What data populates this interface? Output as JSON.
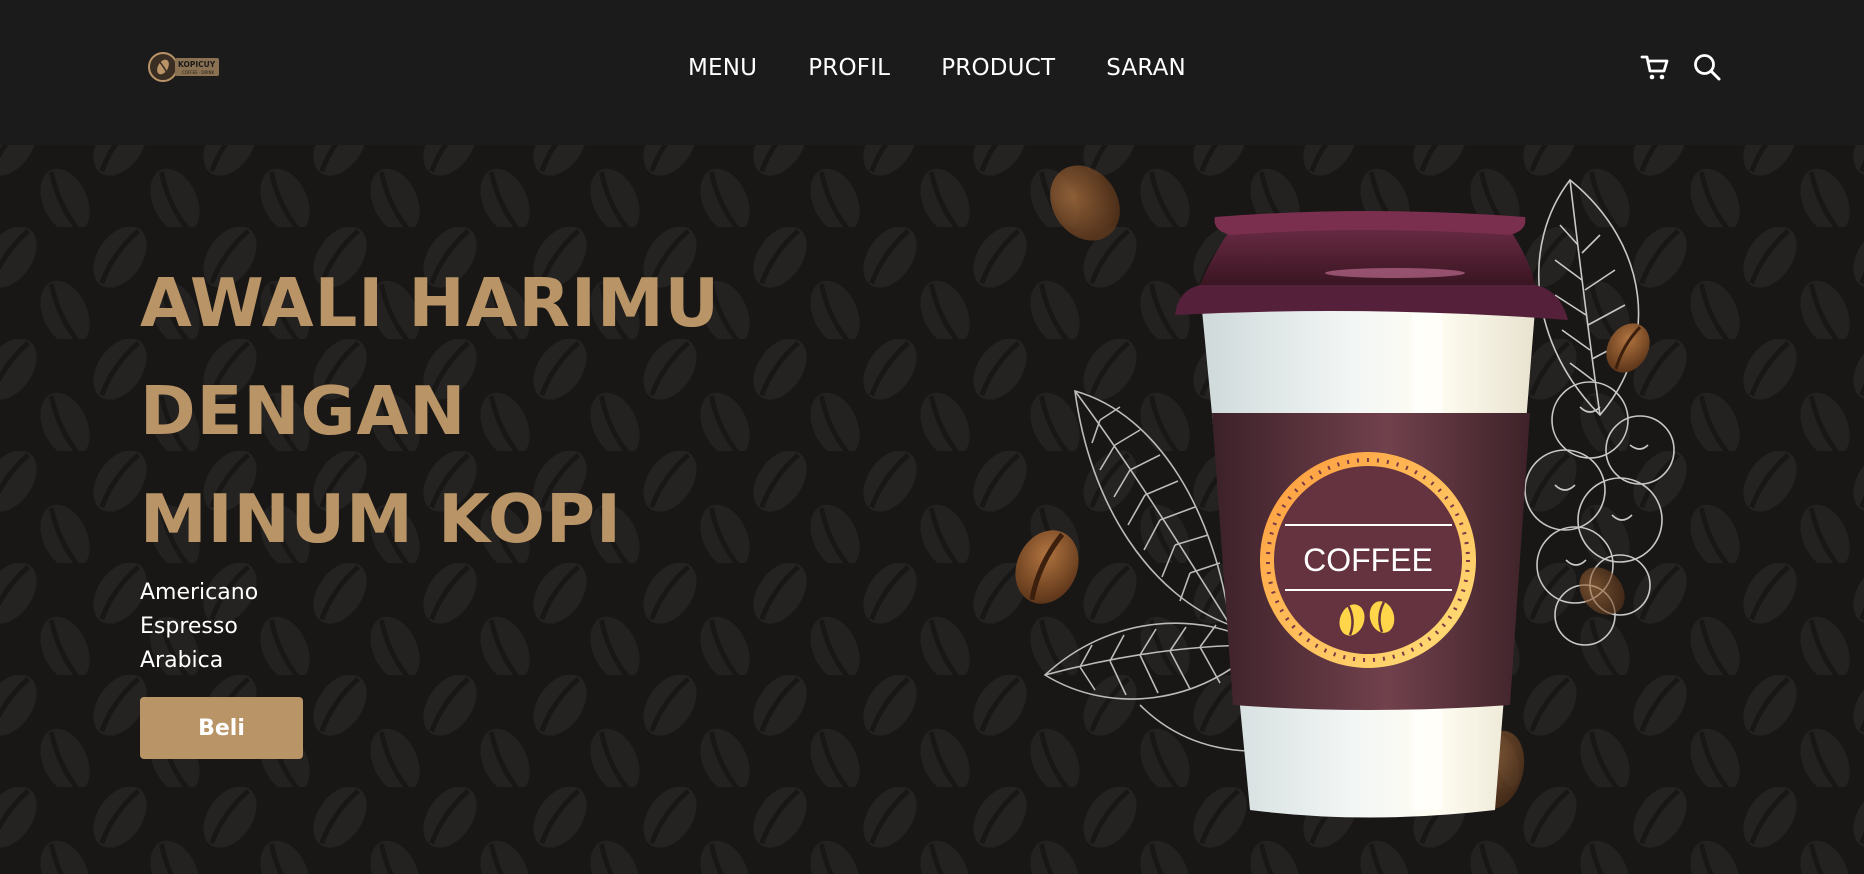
{
  "brand": {
    "name": "KOPICUY",
    "tagline": "COFFEE · DRINK",
    "accent_color": "#b99467",
    "background_color": "#1b1b1b"
  },
  "nav": {
    "items": [
      {
        "label": "MENU"
      },
      {
        "label": "PROFIL"
      },
      {
        "label": "PRODUCT"
      },
      {
        "label": "SARAN"
      }
    ],
    "icons": [
      "cart-icon",
      "search-icon"
    ]
  },
  "hero": {
    "headline_lines": [
      "AWALI HARIMU",
      "DENGAN",
      "MINUM KOPI"
    ],
    "variants": [
      "Americano",
      "Espresso",
      "Arabica"
    ],
    "button_label": "Beli",
    "cup_label": "COFFEE"
  }
}
